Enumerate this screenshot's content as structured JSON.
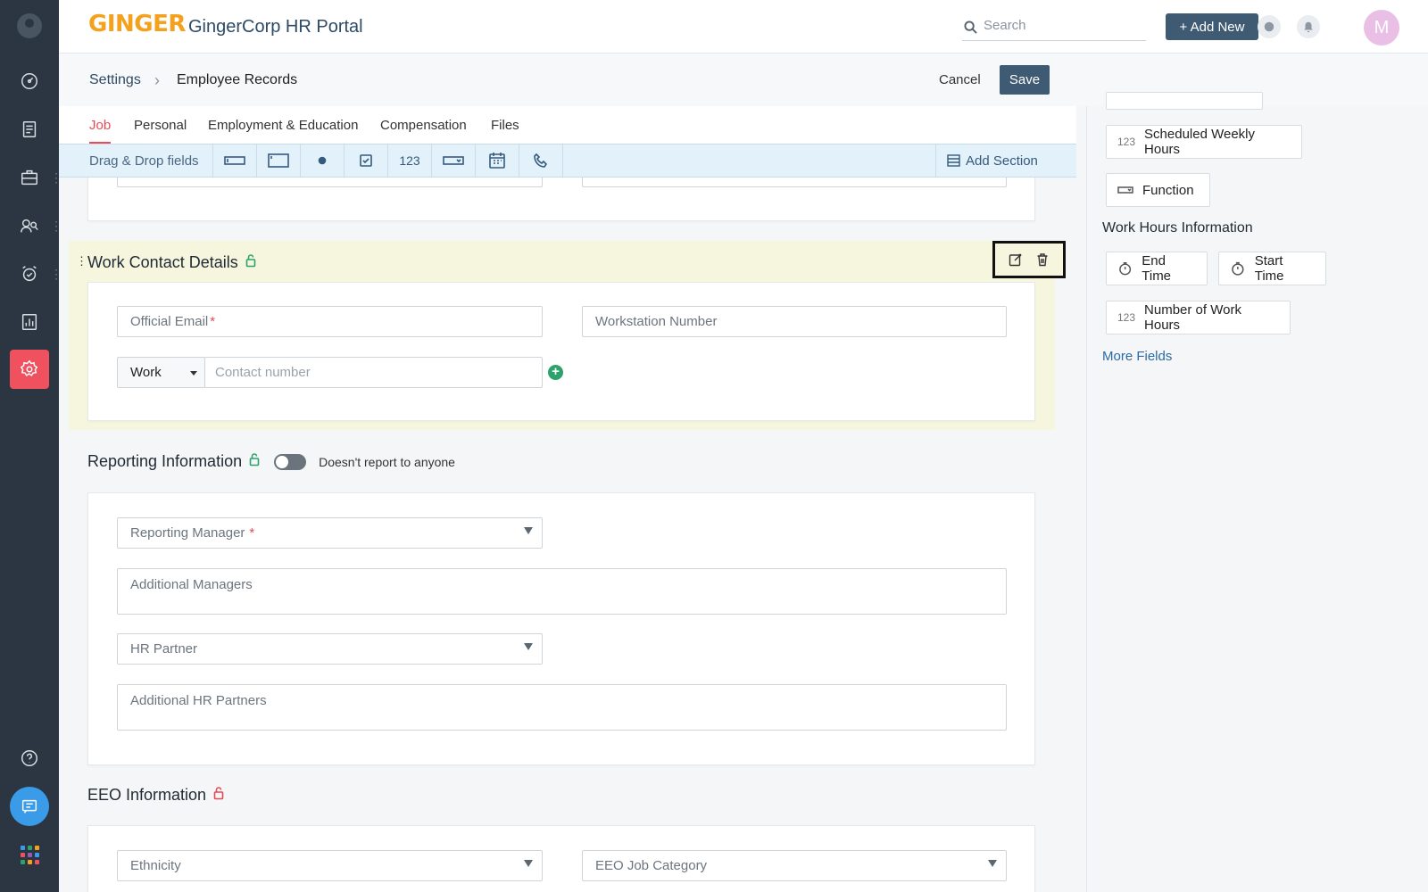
{
  "app": {
    "logo": "GINGER",
    "title": "GingerCorp HR Portal",
    "search_placeholder": "Search",
    "add_new_label": "+ Add New",
    "user_initial": "M"
  },
  "breadcrumb": {
    "root": "Settings",
    "separator": "›",
    "current": "Employee Records"
  },
  "actions": {
    "cancel": "Cancel",
    "save": "Save"
  },
  "tabs": [
    {
      "label": "Job",
      "active": true
    },
    {
      "label": "Personal",
      "active": false
    },
    {
      "label": "Employment & Education",
      "active": false
    },
    {
      "label": "Compensation",
      "active": false
    },
    {
      "label": "Files",
      "active": false
    }
  ],
  "dnd": {
    "label": "Drag & Drop fields",
    "number_label": "123",
    "add_section": "Add Section",
    "items": [
      "single-line-icon",
      "multi-line-icon",
      "radio-icon",
      "checkbox-icon",
      "number-icon",
      "dropdown-icon",
      "calendar-icon",
      "phone-icon"
    ]
  },
  "work_contact": {
    "title": "Work Contact Details",
    "official_email": "Official Email",
    "required_mark": "*",
    "workstation": "Workstation Number",
    "phone_type": "Work",
    "contact_placeholder": "Contact number"
  },
  "reporting": {
    "title": "Reporting Information",
    "toggle_label": "Doesn't report to anyone",
    "toggle_on": false,
    "reporting_manager": "Reporting Manager",
    "required_mark": "*",
    "additional_managers": "Additional Managers",
    "hr_partner": "HR Partner",
    "additional_hr_partners": "Additional HR Partners"
  },
  "eeo": {
    "title": "EEO Information",
    "ethnicity": "Ethnicity",
    "job_category": "EEO Job Category"
  },
  "right_panel": {
    "chips_top": [
      {
        "num": "123",
        "label": "Scheduled Weekly Hours"
      },
      {
        "num": "",
        "label": "Function"
      }
    ],
    "work_hours_heading": "Work Hours Information",
    "work_hours_chips": [
      {
        "label": "End Time"
      },
      {
        "label": "Start Time"
      },
      {
        "num": "123",
        "label": "Number of Work Hours"
      }
    ],
    "more_fields": "More Fields"
  },
  "colors": {
    "sidebar": "#2b3642",
    "accent_red": "#f0515f",
    "primary_button": "#3f5a73",
    "logo": "#f4a21d",
    "highlight_section": "#f6f6df",
    "lock_green": "#2ca36a",
    "lock_red": "#e24b57"
  }
}
